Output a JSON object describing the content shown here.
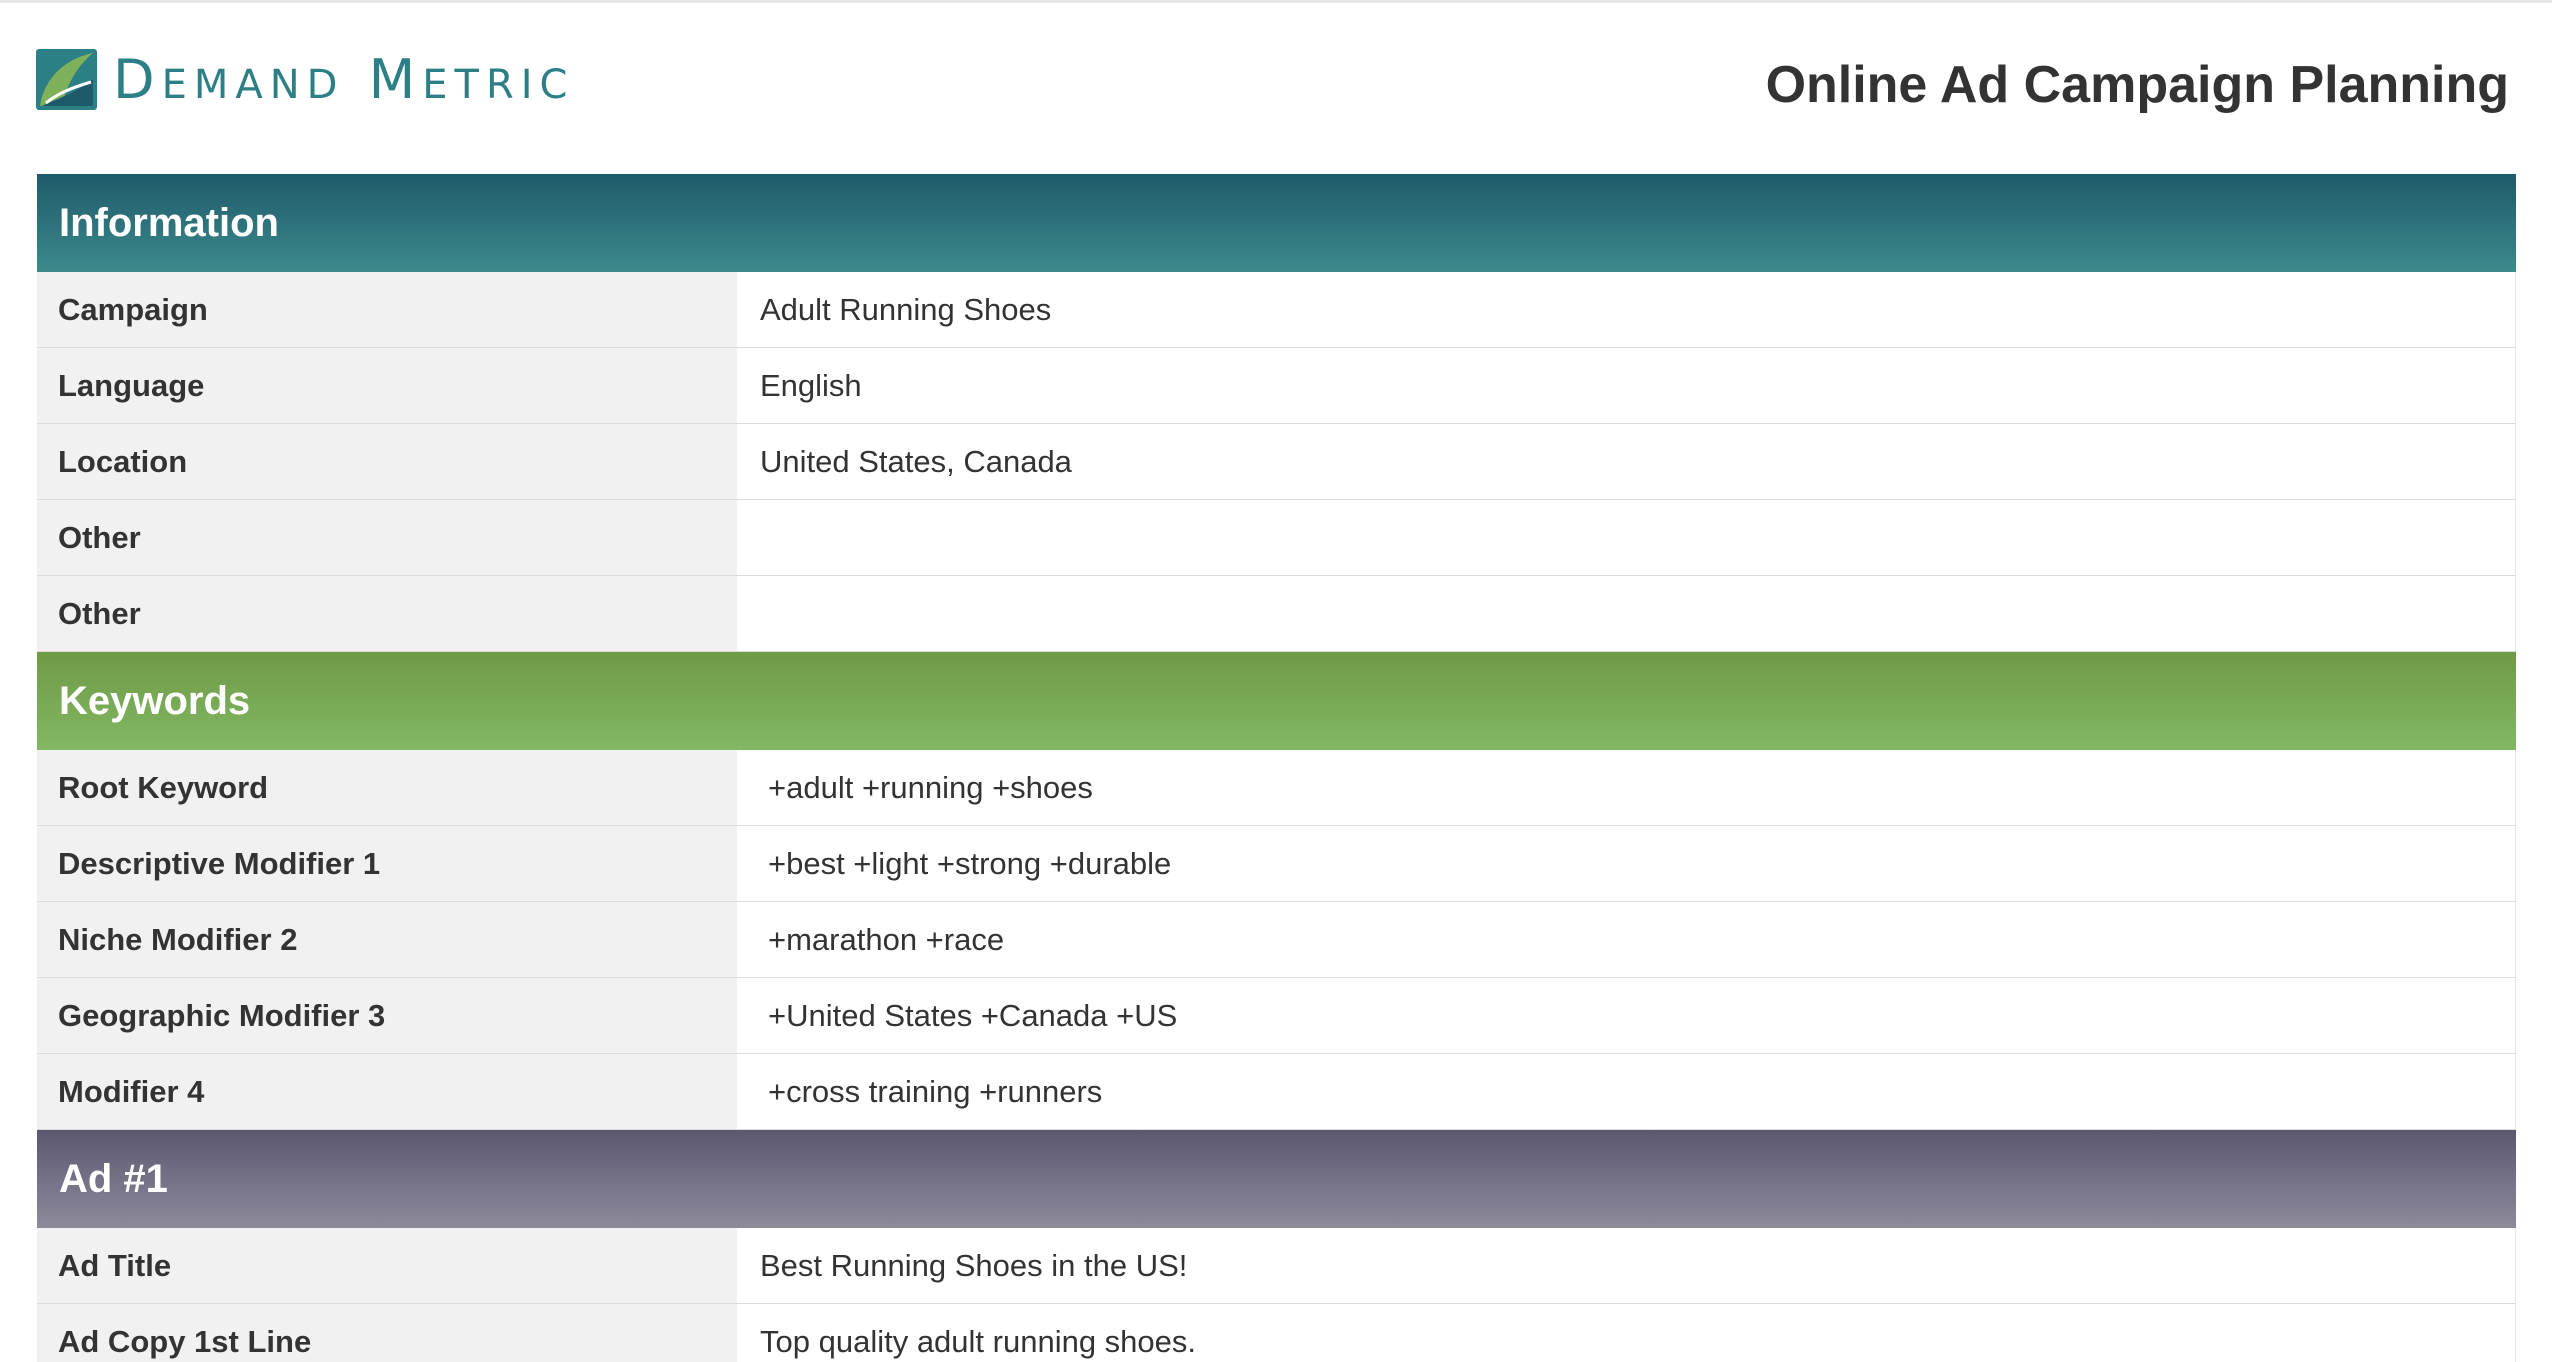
{
  "header": {
    "logo_text_first": "D",
    "logo_text_rest1": "EMAND",
    "logo_text_gap": " ",
    "logo_text_second": "M",
    "logo_text_rest2": "ETRIC",
    "title": "Online Ad Campaign Planning"
  },
  "colors": {
    "brand": "#2d7f86",
    "information_header": "#2a6f78",
    "keywords_header": "#78a656",
    "ad_header": "#726d84"
  },
  "sections": {
    "information": {
      "title": "Information",
      "rows": [
        {
          "label": "Campaign",
          "value": "Adult Running Shoes"
        },
        {
          "label": "Language",
          "value": "English"
        },
        {
          "label": "Location",
          "value": "United States, Canada"
        },
        {
          "label": "Other",
          "value": ""
        },
        {
          "label": "Other",
          "value": ""
        }
      ]
    },
    "keywords": {
      "title": "Keywords",
      "rows": [
        {
          "label": "Root Keyword",
          "value": "+adult +running +shoes"
        },
        {
          "label": "Descriptive Modifier 1",
          "value": "+best +light +strong +durable"
        },
        {
          "label": "Niche Modifier 2",
          "value": "+marathon +race"
        },
        {
          "label": "Geographic Modifier 3",
          "value": "+United States +Canada +US"
        },
        {
          "label": "Modifier 4",
          "value": "+cross training +runners"
        }
      ]
    },
    "ad1": {
      "title": "Ad #1",
      "rows": [
        {
          "label": "Ad Title",
          "value": "Best Running Shoes in the US!"
        },
        {
          "label": "Ad Copy 1st Line",
          "value": "Top quality adult running shoes."
        }
      ]
    }
  }
}
